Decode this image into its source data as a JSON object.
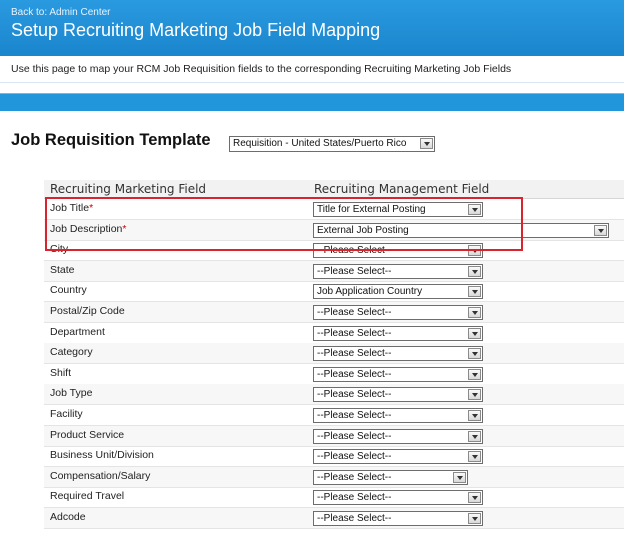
{
  "header": {
    "back_link": "Back to: Admin Center",
    "title": "Setup Recruiting Marketing Job Field Mapping"
  },
  "description": "Use this page to map your RCM Job Requisition fields to the corresponding Recruiting Marketing Job Fields",
  "template": {
    "label": "Job Requisition Template",
    "selected": "Requisition - United States/Puerto Rico"
  },
  "table": {
    "col_marketing": "Recruiting Marketing Field",
    "col_management": "Recruiting Management Field",
    "rows": [
      {
        "label": "Job Title",
        "required": "*",
        "value": "Title for External Posting"
      },
      {
        "label": "Job Description",
        "required": "*",
        "value": "External Job Posting"
      },
      {
        "label": "City",
        "required": "",
        "value": "--Please Select--"
      },
      {
        "label": "State",
        "required": "",
        "value": "--Please Select--"
      },
      {
        "label": "Country",
        "required": "",
        "value": "Job Application Country"
      },
      {
        "label": "Postal/Zip Code",
        "required": "",
        "value": "--Please Select--"
      },
      {
        "label": "Department",
        "required": "",
        "value": "--Please Select--"
      },
      {
        "label": "Category",
        "required": "",
        "value": "--Please Select--"
      },
      {
        "label": "Shift",
        "required": "",
        "value": "--Please Select--"
      },
      {
        "label": "Job Type",
        "required": "",
        "value": "--Please Select--"
      },
      {
        "label": "Facility",
        "required": "",
        "value": "--Please Select--"
      },
      {
        "label": "Product Service",
        "required": "",
        "value": "--Please Select--"
      },
      {
        "label": "Business Unit/Division",
        "required": "",
        "value": "--Please Select--"
      },
      {
        "label": "Compensation/Salary",
        "required": "",
        "value": "--Please Select--"
      },
      {
        "label": "Required Travel",
        "required": "",
        "value": "--Please Select--"
      },
      {
        "label": "Adcode",
        "required": "",
        "value": "--Please Select--"
      }
    ]
  },
  "colors": {
    "header": "#1e8fd6",
    "highlight": "#d9232e",
    "required": "#cc0000"
  }
}
